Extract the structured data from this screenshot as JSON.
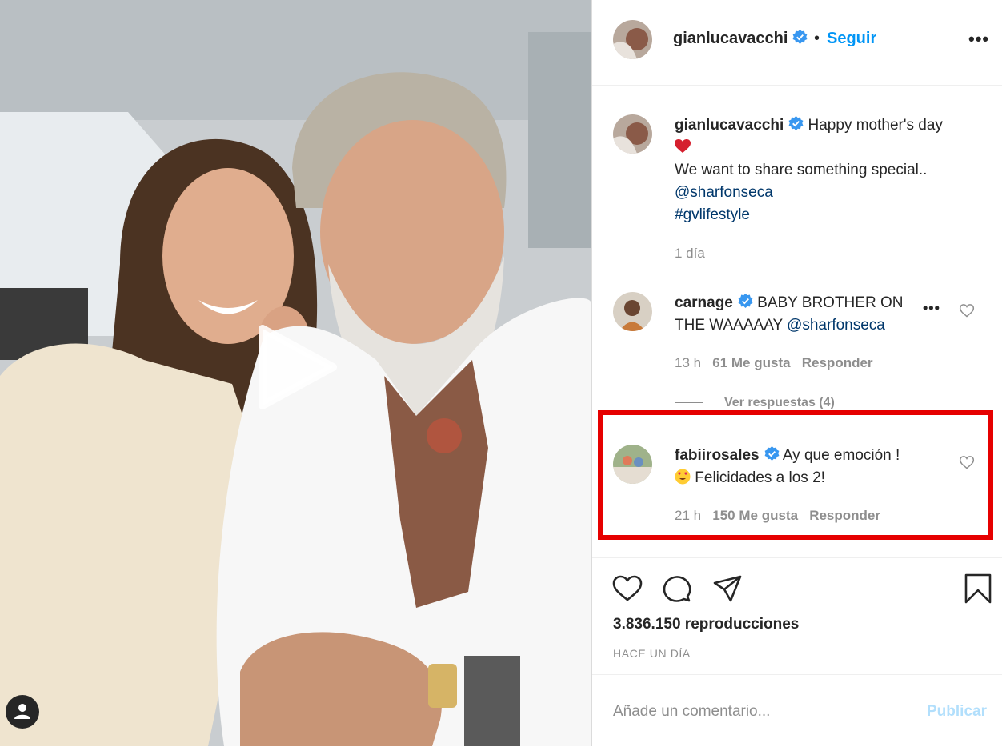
{
  "header": {
    "username": "gianlucavacchi",
    "separator": "•",
    "follow_label": "Seguir",
    "more_label": "•••"
  },
  "caption": {
    "username": "gianlucavacchi",
    "text_line1": "Happy mother's day",
    "emoji": "heart-emoji",
    "text_line2": "We want to share something special..",
    "mention": "@sharfonseca",
    "hashtag": "#gvlifestyle",
    "time": "1 día"
  },
  "comments": [
    {
      "username": "carnage",
      "text": "BABY BROTHER ON THE WAAAAAY",
      "mention": "@sharfonseca",
      "time": "13 h",
      "likes": "61 Me gusta",
      "reply_label": "Responder",
      "view_replies": "Ver respuestas (4)",
      "more_label": "•••"
    },
    {
      "username": "fabiirosales",
      "text_line1": "Ay que emoción !",
      "emoji": "heart-eyes-emoji",
      "text_line2": "Felicidades a los 2!",
      "time": "21 h",
      "likes": "150 Me gusta",
      "reply_label": "Responder"
    }
  ],
  "actions": {
    "views": "3.836.150 reproducciones",
    "posted_ago": "HACE UN DÍA"
  },
  "add_comment": {
    "placeholder": "Añade un comentario...",
    "publish_label": "Publicar"
  },
  "colors": {
    "link_blue": "#0095f6",
    "mention_blue": "#00376b",
    "highlight_red": "#e60000",
    "muted_gray": "#8e8e8e",
    "verified_blue": "#3897f0"
  }
}
